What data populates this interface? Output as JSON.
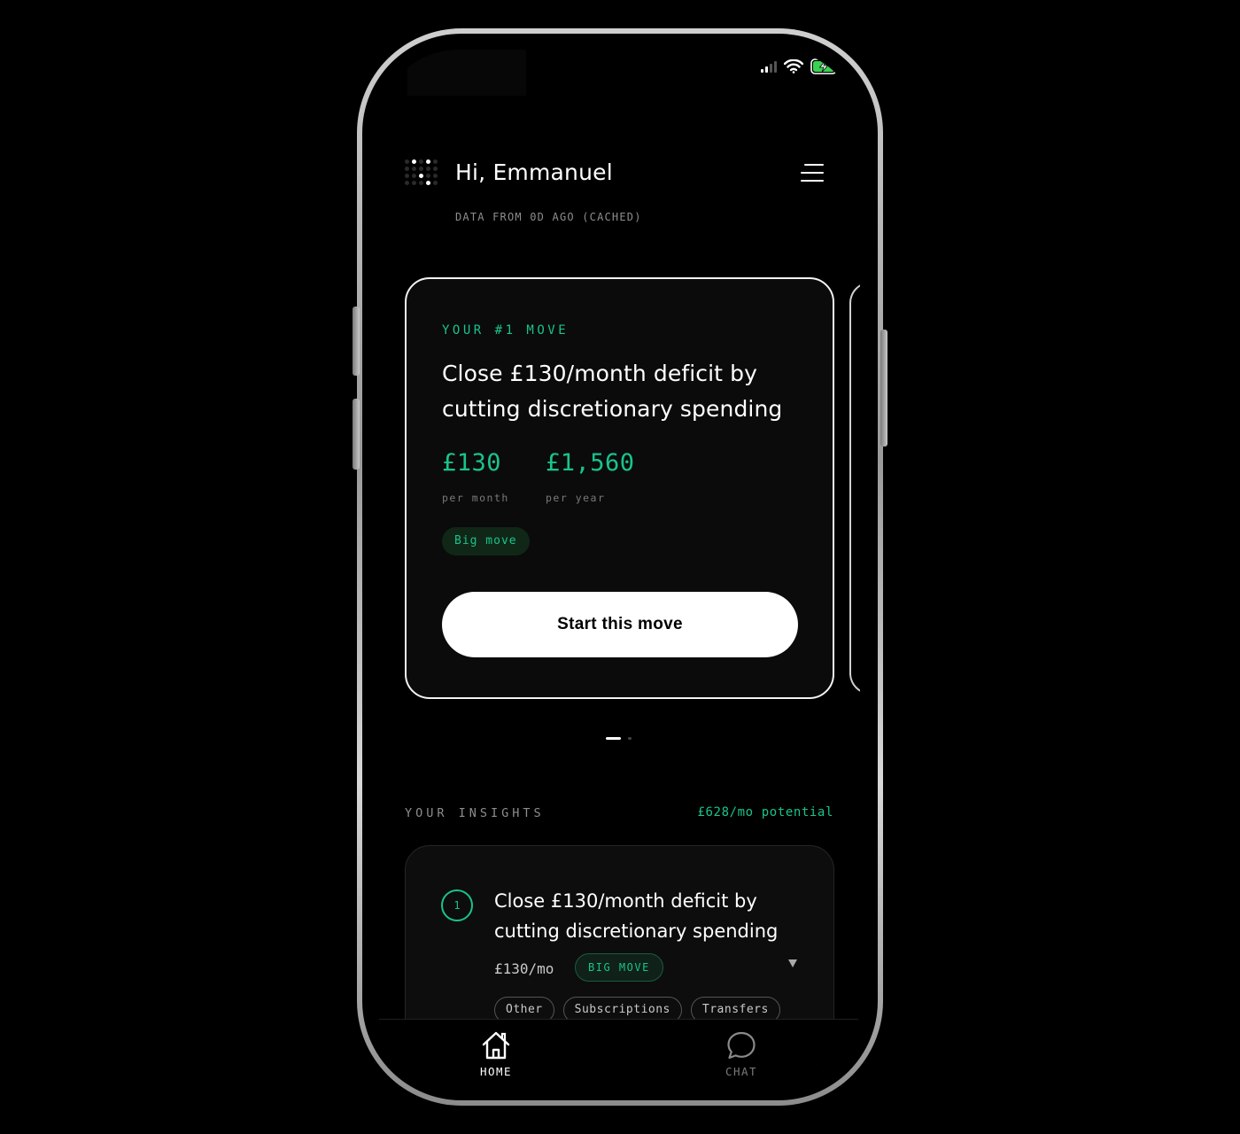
{
  "header": {
    "greeting": "Hi, Emmanuel",
    "cache_note": "DATA FROM 0D AGO (CACHED)"
  },
  "hero": {
    "kicker": "YOUR #1 MOVE",
    "title": "Close £130/month deficit by cutting discretionary spending",
    "stats": [
      {
        "value": "£130",
        "label": "per month"
      },
      {
        "value": "£1,560",
        "label": "per year"
      }
    ],
    "badge": "Big move",
    "cta": "Start this move"
  },
  "pager": {
    "total": 2,
    "active": 1
  },
  "insights": {
    "label": "YOUR INSIGHTS",
    "potential": "£628/mo potential",
    "items": [
      {
        "number": "1",
        "title": "Close £130/month deficit by cutting discretionary spending",
        "amount": "£130/mo",
        "badge": "BIG MOVE",
        "chips": [
          "Other",
          "Subscriptions",
          "Transfers"
        ]
      }
    ]
  },
  "tabs": [
    {
      "label": "HOME",
      "icon": "home-icon",
      "active": true
    },
    {
      "label": "CHAT",
      "icon": "chat-icon",
      "active": false
    }
  ],
  "colors": {
    "accent": "#19c38c",
    "background": "#000000",
    "card": "#0b0b0b"
  }
}
